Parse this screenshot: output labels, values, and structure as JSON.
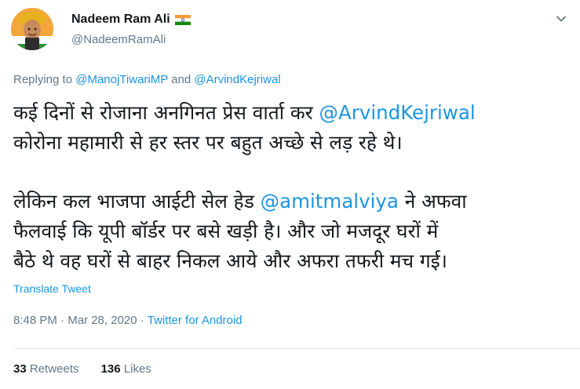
{
  "user": {
    "display_name": "Nadeem Ram Ali",
    "handle": "@NadeemRamAli",
    "flag_icon": "india-flag-icon"
  },
  "reply": {
    "prefix": "Replying to",
    "mention1": "@ManojTiwariMP",
    "conjunction": "and",
    "mention2": "@ArvindKejriwal"
  },
  "tweet": {
    "line1_text": "कई दिनों से रोजाना अनगिनत प्रेस वार्ता कर ",
    "line1_mention": "@ArvindKejriwal",
    "line2_text": " कोरोना महामारी से हर स्तर पर बहुत अच्छे से लड़ रहे थे।",
    "line3_text": "लेकिन कल भाजपा आईटी सेल हेड ",
    "line3_mention": "@amitmalviya",
    "line3_after": " ने अफवा",
    "line4_text": "फैलवाई कि यूपी बॉर्डर पर बसे खड़ी है। और जो मजदूर घरों में",
    "line5_text": "बैठे थे वह घरों से बाहर निकल आये और अफरा तफरी मच गई।"
  },
  "translate_label": "Translate Tweet",
  "meta": {
    "time": "8:48 PM",
    "separator": "·",
    "date": "Mar 28, 2020",
    "source": "Twitter for Android"
  },
  "stats": {
    "retweets_count": "33",
    "retweets_label": "Retweets",
    "likes_count": "136",
    "likes_label": "Likes"
  },
  "colors": {
    "link": "#1b95e0",
    "secondary": "#657786",
    "primary_text": "#14171a"
  }
}
